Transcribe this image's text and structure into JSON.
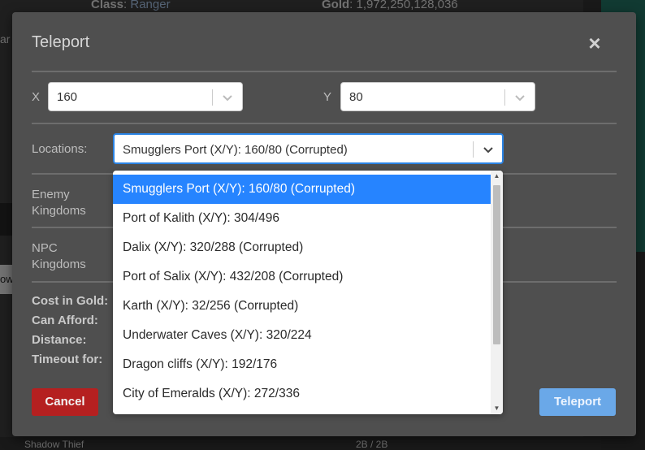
{
  "background": {
    "class_label": "Class",
    "class_value": "Ranger",
    "gold_label": "Gold",
    "gold_value": "1,972,250,128,036",
    "bottom_left": "Shadow Thief",
    "bottom_right": "2B / 2B",
    "left_tab": "ar",
    "left_button": "ow"
  },
  "modal": {
    "title": "Teleport",
    "close_symbol": "×",
    "x_label": "X",
    "x_value": "160",
    "y_label": "Y",
    "y_value": "80",
    "locations_label": "Locations:",
    "locations_value": "Smugglers Port (X/Y): 160/80 (Corrupted)",
    "enemy_kingdoms_label": "Enemy Kingdoms",
    "npc_kingdoms_label": "NPC Kingdoms",
    "info": [
      {
        "label": "Cost in Gold:"
      },
      {
        "label": "Can Afford:"
      },
      {
        "label": "Distance:"
      },
      {
        "label": "Timeout for:"
      }
    ],
    "cancel_label": "Cancel",
    "teleport_label": "Teleport"
  },
  "dropdown": {
    "options": [
      "Smugglers Port (X/Y): 160/80 (Corrupted)",
      "Port of Kalith (X/Y): 304/496",
      "Dalix (X/Y): 320/288 (Corrupted)",
      "Port of Salix (X/Y): 432/208 (Corrupted)",
      "Karth (X/Y): 32/256 (Corrupted)",
      "Underwater Caves (X/Y): 320/224",
      "Dragon cliffs (X/Y): 192/176",
      "City of Emeralds (X/Y): 272/336"
    ],
    "selected_index": 0
  },
  "colors": {
    "accent": "#2684ff",
    "danger": "#b52020",
    "primary": "#6aa8e8"
  }
}
